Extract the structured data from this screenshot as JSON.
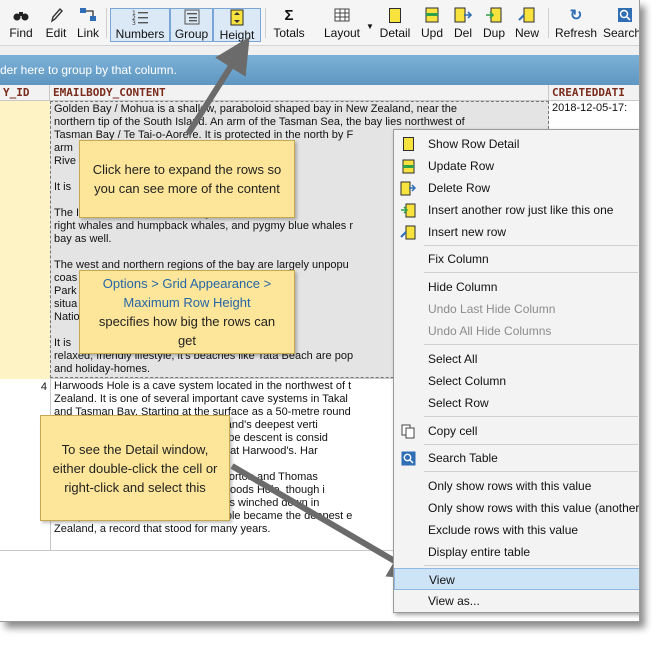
{
  "toolbar": {
    "find": "Find",
    "edit": "Edit",
    "link": "Link",
    "numbers": "Numbers",
    "group": "Group",
    "height": "Height",
    "totals": "Totals",
    "layout": "Layout",
    "detail": "Detail",
    "upd": "Upd",
    "del": "Del",
    "dup": "Dup",
    "new": "New",
    "refresh": "Refresh",
    "search": "Search"
  },
  "group_bar": "der here to group by that column.",
  "grid": {
    "columns": [
      "Y_ID",
      "EMAILBODY_CONTENT",
      "CREATEDDATI"
    ],
    "rows": [
      {
        "id": "3",
        "date": "2018-12-05-17:",
        "text": "Golden Bay / Mohua is a shallow, paraboloid shaped bay in New Zealand, near the\nnorthern tip of the South Island. An arm of the Tasman Sea, the bay lies northwest of\nTasman Bay / Te Tai-o-Aorere. It is protected in the north by F\narm                                    s longest sandsp\nRive\n\nIt is                                      he territorial auth\n\nThe I                                      ing whales and do\nright whales and humpback whales, and pygmy blue whales r\nbay as well.\n\nThe west and northern regions of the bay are largely unpopu\ncoas                                      ood, and also the\nPark                                      y between Golden\nsitua                                      oit approaches to\nNatio\n\nIt is                                      nation, because o\nrelaxed, friendly lifestyle, it's beaches like Tata Beach are pop\nand holiday-homes."
      },
      {
        "id": "4",
        "date": "",
        "text": "Harwoods Hole is a cave system located in the northwest of t\nZealand. It is one of several important cave systems in Takal\nand Tasman Bay. Starting at the surface as a 50-metre round\n                                         New Zealand's deepest verti\n                                         he long rope descent is consid\n                                         xperience at Harwood's. Har\n\n                                         ith John Horton and Thomas\n                                         ered Harwoods Hole, though i\n                                         until cavers winched down in\nof exploration in 1959, Harwoods Hole became the deepest e\nZealand, a record that stood for many years."
      }
    ]
  },
  "callouts": {
    "expand": "Click here to expand the rows so you can see more of the content",
    "options_blue": "Options > Grid Appearance > Maximum Row Height",
    "options_rest": "specifies how big the rows can get",
    "detail": "To see the Detail window, either double-click the cell or right-click and select this"
  },
  "context_menu": {
    "show_row_detail": "Show Row Detail",
    "update_row": "Update Row",
    "delete_row": "Delete Row",
    "insert_like": "Insert another row just like this one",
    "insert_new": "Insert new row",
    "fix_column": "Fix Column",
    "hide_column": "Hide Column",
    "undo_last_hide": "Undo Last Hide Column",
    "undo_all_hide": "Undo All Hide Columns",
    "select_all": "Select All",
    "select_column": "Select Column",
    "select_row": "Select Row",
    "copy_cell": "Copy cell",
    "search_table": "Search Table",
    "only_show_this": "Only show rows with this value",
    "only_show_another": "Only show rows with this value (another",
    "exclude_rows": "Exclude rows with this value",
    "display_entire": "Display entire table",
    "view": "View",
    "view_as": "View as..."
  },
  "colors": {
    "group_bar": "#6ea4cc",
    "row_highlight": "#fdf3c4",
    "callout": "#fde699",
    "menu_highlight": "#cde3f6",
    "arrow": "#6b6b6b"
  }
}
